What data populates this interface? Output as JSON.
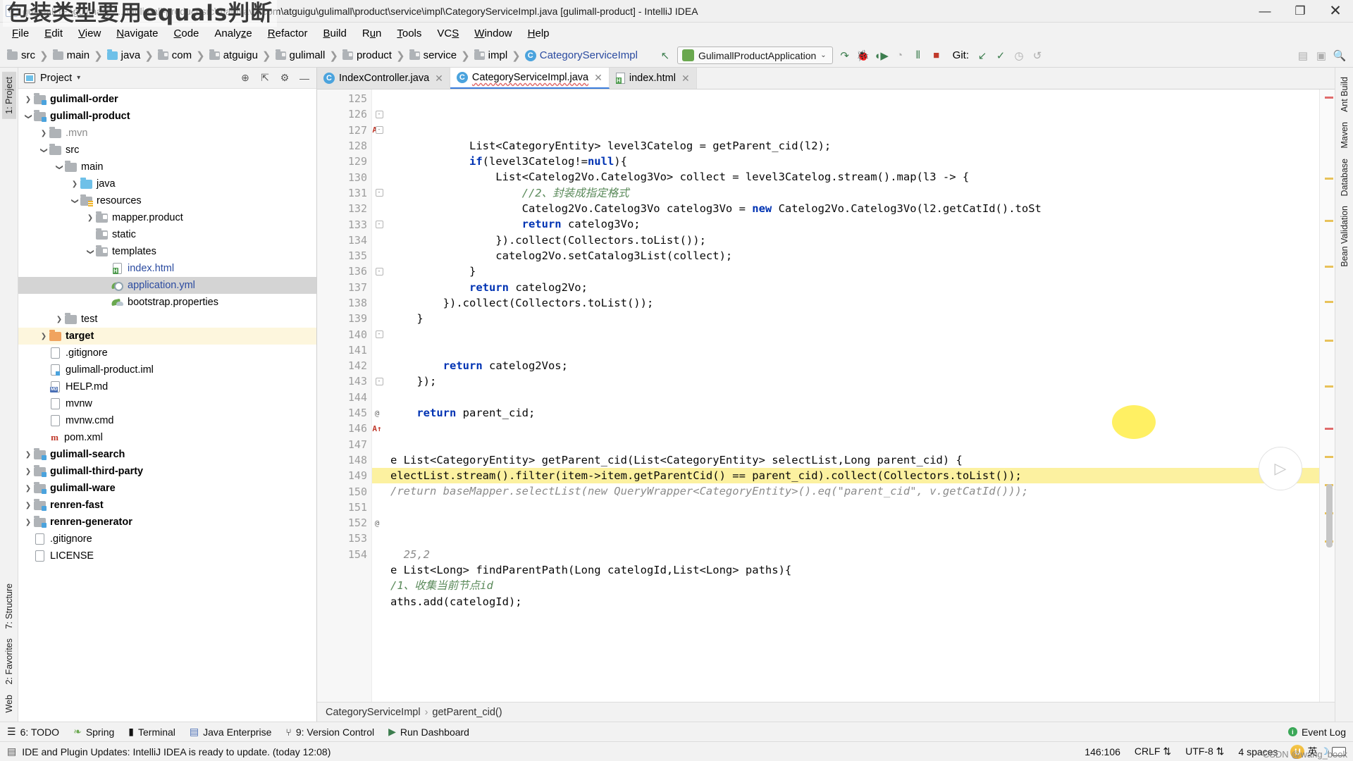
{
  "annotation": {
    "text": "包装类型要用equals判断"
  },
  "titlebar": {
    "icon": "intellij-logo-icon",
    "title": "gulimall [F:\\gulimall] - ...\\gulimall-product\\src\\main\\java\\com\\atguigu\\gulimall\\product\\service\\impl\\CategoryServiceImpl.java [gulimall-product] - IntelliJ IDEA",
    "minimize": "—",
    "maximize": "❐",
    "close": "✕"
  },
  "menubar": {
    "items": [
      {
        "label": "File"
      },
      {
        "label": "Edit"
      },
      {
        "label": "View"
      },
      {
        "label": "Navigate"
      },
      {
        "label": "Code"
      },
      {
        "label": "Analyze"
      },
      {
        "label": "Refactor"
      },
      {
        "label": "Build"
      },
      {
        "label": "Run"
      },
      {
        "label": "Tools"
      },
      {
        "label": "VCS"
      },
      {
        "label": "Window"
      },
      {
        "label": "Help"
      }
    ]
  },
  "navbar": {
    "crumbs": [
      {
        "label": "src",
        "kind": "folder"
      },
      {
        "label": "main",
        "kind": "folder"
      },
      {
        "label": "java",
        "kind": "folder-blue"
      },
      {
        "label": "com",
        "kind": "package"
      },
      {
        "label": "atguigu",
        "kind": "package"
      },
      {
        "label": "gulimall",
        "kind": "package"
      },
      {
        "label": "product",
        "kind": "package"
      },
      {
        "label": "service",
        "kind": "package"
      },
      {
        "label": "impl",
        "kind": "package"
      },
      {
        "label": "CategoryServiceImpl",
        "kind": "class"
      }
    ],
    "back_icon": "back-arrow-icon",
    "run_config": {
      "name": "GulimallProductApplication",
      "icon": "spring-boot-icon",
      "chevron": "⌄"
    },
    "run_icons": [
      {
        "name": "run-icon",
        "glyph": "↷"
      },
      {
        "name": "debug-icon",
        "glyph": "🐞"
      },
      {
        "name": "run-with-coverage-icon",
        "glyph": "▶"
      },
      {
        "name": "profiler-icon",
        "glyph": "◔"
      },
      {
        "name": "attach-debugger-icon",
        "glyph": "⦀"
      },
      {
        "name": "stop-icon",
        "glyph": "■"
      }
    ],
    "git": {
      "label": "Git:",
      "icons": [
        {
          "name": "update-project-icon",
          "glyph": "↙"
        },
        {
          "name": "commit-icon",
          "glyph": "✓"
        },
        {
          "name": "history-icon",
          "glyph": "◷"
        },
        {
          "name": "rollback-icon",
          "glyph": "↺"
        }
      ]
    },
    "right_icons": [
      {
        "name": "search-everywhere-icon",
        "glyph": "▤"
      },
      {
        "name": "settings-icon",
        "glyph": "▣"
      },
      {
        "name": "magnifier-icon",
        "glyph": "🔍"
      }
    ]
  },
  "left_strip": {
    "top": [
      {
        "label": "1: Project",
        "name": "sidebar-tab-project",
        "selected": true
      }
    ],
    "bottom": [
      {
        "label": "7: Structure",
        "name": "sidebar-tab-structure"
      },
      {
        "label": "2: Favorites",
        "name": "sidebar-tab-favorites"
      },
      {
        "label": "Web",
        "name": "sidebar-tab-web"
      }
    ]
  },
  "right_strip": {
    "items": [
      {
        "label": "Ant Build",
        "name": "sidebar-tab-ant-build"
      },
      {
        "label": "Maven",
        "name": "sidebar-tab-maven"
      },
      {
        "label": "Database",
        "name": "sidebar-tab-database"
      },
      {
        "label": "Bean Validation",
        "name": "sidebar-tab-bean-validation"
      }
    ]
  },
  "project_panel": {
    "title": "Project",
    "chevron": "▾",
    "header_icons": [
      {
        "name": "scroll-from-source-icon",
        "glyph": "⊕"
      },
      {
        "name": "collapse-all-icon",
        "glyph": "⇱"
      },
      {
        "name": "settings-icon",
        "glyph": "⚙"
      },
      {
        "name": "hide-icon",
        "glyph": "—"
      }
    ],
    "tree": [
      {
        "label": "gulimall-order",
        "indent": 1,
        "arrow": "collapsed",
        "icon": "module-folder",
        "bold": true
      },
      {
        "label": "gulimall-product",
        "indent": 1,
        "arrow": "expanded",
        "icon": "module-folder",
        "bold": true
      },
      {
        "label": ".mvn",
        "indent": 2,
        "arrow": "collapsed",
        "icon": "folder",
        "dim": true
      },
      {
        "label": "src",
        "indent": 2,
        "arrow": "expanded",
        "icon": "folder"
      },
      {
        "label": "main",
        "indent": 3,
        "arrow": "expanded",
        "icon": "folder"
      },
      {
        "label": "java",
        "indent": 4,
        "arrow": "collapsed",
        "icon": "folder-blue"
      },
      {
        "label": "resources",
        "indent": 4,
        "arrow": "expanded",
        "icon": "folder-resources"
      },
      {
        "label": "mapper.product",
        "indent": 5,
        "arrow": "collapsed",
        "icon": "package"
      },
      {
        "label": "static",
        "indent": 5,
        "arrow": "none",
        "icon": "package"
      },
      {
        "label": "templates",
        "indent": 5,
        "arrow": "expanded",
        "icon": "package"
      },
      {
        "label": "index.html",
        "indent": 6,
        "arrow": "none",
        "icon": "html-file",
        "blue": true
      },
      {
        "label": "application.yml",
        "indent": 6,
        "arrow": "none",
        "icon": "yml-file",
        "blue": true,
        "selected": true
      },
      {
        "label": "bootstrap.properties",
        "indent": 6,
        "arrow": "none",
        "icon": "properties-file"
      },
      {
        "label": "test",
        "indent": 3,
        "arrow": "collapsed",
        "icon": "folder"
      },
      {
        "label": "target",
        "indent": 2,
        "arrow": "collapsed",
        "icon": "folder-orange",
        "bold": true,
        "warn": true
      },
      {
        "label": ".gitignore",
        "indent": 2,
        "arrow": "none",
        "icon": "text-file"
      },
      {
        "label": "gulimall-product.iml",
        "indent": 2,
        "arrow": "none",
        "icon": "iml-file"
      },
      {
        "label": "HELP.md",
        "indent": 2,
        "arrow": "none",
        "icon": "md-file"
      },
      {
        "label": "mvnw",
        "indent": 2,
        "arrow": "none",
        "icon": "text-file"
      },
      {
        "label": "mvnw.cmd",
        "indent": 2,
        "arrow": "none",
        "icon": "text-file"
      },
      {
        "label": "pom.xml",
        "indent": 2,
        "arrow": "none",
        "icon": "maven-file"
      },
      {
        "label": "gulimall-search",
        "indent": 1,
        "arrow": "collapsed",
        "icon": "module-folder",
        "bold": true
      },
      {
        "label": "gulimall-third-party",
        "indent": 1,
        "arrow": "collapsed",
        "icon": "module-folder",
        "bold": true
      },
      {
        "label": "gulimall-ware",
        "indent": 1,
        "arrow": "collapsed",
        "icon": "module-folder",
        "bold": true
      },
      {
        "label": "renren-fast",
        "indent": 1,
        "arrow": "collapsed",
        "icon": "module-folder",
        "bold": true
      },
      {
        "label": "renren-generator",
        "indent": 1,
        "arrow": "collapsed",
        "icon": "module-folder",
        "bold": true
      },
      {
        "label": ".gitignore",
        "indent": 1,
        "arrow": "none",
        "icon": "text-file"
      },
      {
        "label": "LICENSE",
        "indent": 1,
        "arrow": "none",
        "icon": "text-file"
      }
    ]
  },
  "editor": {
    "tabs": [
      {
        "label": "IndexController.java",
        "icon": "java-class-icon",
        "active": false,
        "close": "✕"
      },
      {
        "label": "CategoryServiceImpl.java",
        "icon": "java-class-icon",
        "active": true,
        "close": "✕",
        "error": true
      },
      {
        "label": "index.html",
        "icon": "html-file-icon",
        "active": false,
        "close": "✕"
      }
    ],
    "first_line": 125,
    "lines": [
      {
        "n": 125,
        "text": "            List<CategoryEntity> level3Catelog = getParent_cid(l2);"
      },
      {
        "n": 126,
        "text": "            if(level3Catelog!=null){",
        "fold": "end"
      },
      {
        "n": 127,
        "text": "                List<Catelog2Vo.Catelog3Vo> collect = level3Catelog.stream().map(l3 -> {",
        "gmark": "A↑",
        "fold": "end"
      },
      {
        "n": 128,
        "text": "                    //2、封装成指定格式",
        "comment": true
      },
      {
        "n": 129,
        "text": "                    Catelog2Vo.Catelog3Vo catelog3Vo = new Catelog2Vo.Catelog3Vo(l2.getCatId().toSt"
      },
      {
        "n": 130,
        "text": "                    return catelog3Vo;"
      },
      {
        "n": 131,
        "text": "                }).collect(Collectors.toList());",
        "fold": "end"
      },
      {
        "n": 132,
        "text": "                catelog2Vo.setCatalog3List(collect);"
      },
      {
        "n": 133,
        "text": "            }",
        "fold": "end"
      },
      {
        "n": 134,
        "text": "            return catelog2Vo;"
      },
      {
        "n": 135,
        "text": "        }).collect(Collectors.toList());"
      },
      {
        "n": 136,
        "text": "    }",
        "fold": "end"
      },
      {
        "n": 137,
        "text": ""
      },
      {
        "n": 138,
        "text": ""
      },
      {
        "n": 139,
        "text": "        return catelog2Vos;"
      },
      {
        "n": 140,
        "text": "    });",
        "fold": "end"
      },
      {
        "n": 141,
        "text": ""
      },
      {
        "n": 142,
        "text": "    return parent_cid;"
      },
      {
        "n": 143,
        "text": "",
        "fold": "end"
      },
      {
        "n": 144,
        "text": ""
      },
      {
        "n": 145,
        "text": "e List<CategoryEntity> getParent_cid(List<CategoryEntity> selectList,Long parent_cid) {",
        "gmark": "@"
      },
      {
        "n": 146,
        "text": "electList.stream().filter(item->item.getParentCid() == parent_cid).collect(Collectors.toList());",
        "gmark": "A↑",
        "highlight": true
      },
      {
        "n": 147,
        "text": "/return baseMapper.selectList(new QueryWrapper<CategoryEntity>().eq(\"parent_cid\", v.getCatId()));",
        "comment": true
      },
      {
        "n": 148,
        "text": ""
      },
      {
        "n": 149,
        "text": "",
        "fold": "end"
      },
      {
        "n": 150,
        "text": ""
      },
      {
        "n": 151,
        "text": "  25,2",
        "comment": true
      },
      {
        "n": 152,
        "text": "e List<Long> findParentPath(Long catelogId,List<Long> paths){",
        "gmark": "@"
      },
      {
        "n": 153,
        "text": "/1、收集当前节点id",
        "comment": true
      },
      {
        "n": 154,
        "text": "aths.add(catelogId);"
      }
    ],
    "breadcrumb": [
      "CategoryServiceImpl",
      "getParent_cid()"
    ],
    "breadcrumb_sep": "›"
  },
  "toolstrip": {
    "items": [
      {
        "label": "6: TODO",
        "name": "tool-tab-todo",
        "icon": "todo-icon"
      },
      {
        "label": "Spring",
        "name": "tool-tab-spring",
        "icon": "spring-icon"
      },
      {
        "label": "Terminal",
        "name": "tool-tab-terminal",
        "icon": "terminal-icon"
      },
      {
        "label": "Java Enterprise",
        "name": "tool-tab-java-enterprise",
        "icon": "java-ee-icon"
      },
      {
        "label": "9: Version Control",
        "name": "tool-tab-version-control",
        "icon": "branch-icon"
      },
      {
        "label": "Run Dashboard",
        "name": "tool-tab-run-dashboard",
        "icon": "run-icon"
      }
    ],
    "event_log": {
      "label": "Event Log",
      "icon": "event-log-icon"
    }
  },
  "statusbar": {
    "message": "IDE and Plugin Updates: IntelliJ IDEA is ready to update. (today 12:08)",
    "message_icon": "info-icon",
    "caret": "146:106",
    "line_separator": "CRLF",
    "encoding": "UTF-8",
    "indent": "4 spaces",
    "chevron": "⇅",
    "ime": {
      "ball": "U",
      "lang": "英",
      "moon": "☽",
      "keyboard": "keyboard-icon"
    }
  },
  "watermark": "CSDN @wang_book",
  "colors": {
    "accent_blue": "#2b4ba0",
    "keyword": "#0033b3",
    "string": "#067d17",
    "comment": "#8c8c8c",
    "highlight_yellow": "#fcf1a0",
    "selection_grey": "#d4d4d4",
    "warn_row": "#fdf6dd",
    "green_run": "#3c7d4e"
  }
}
